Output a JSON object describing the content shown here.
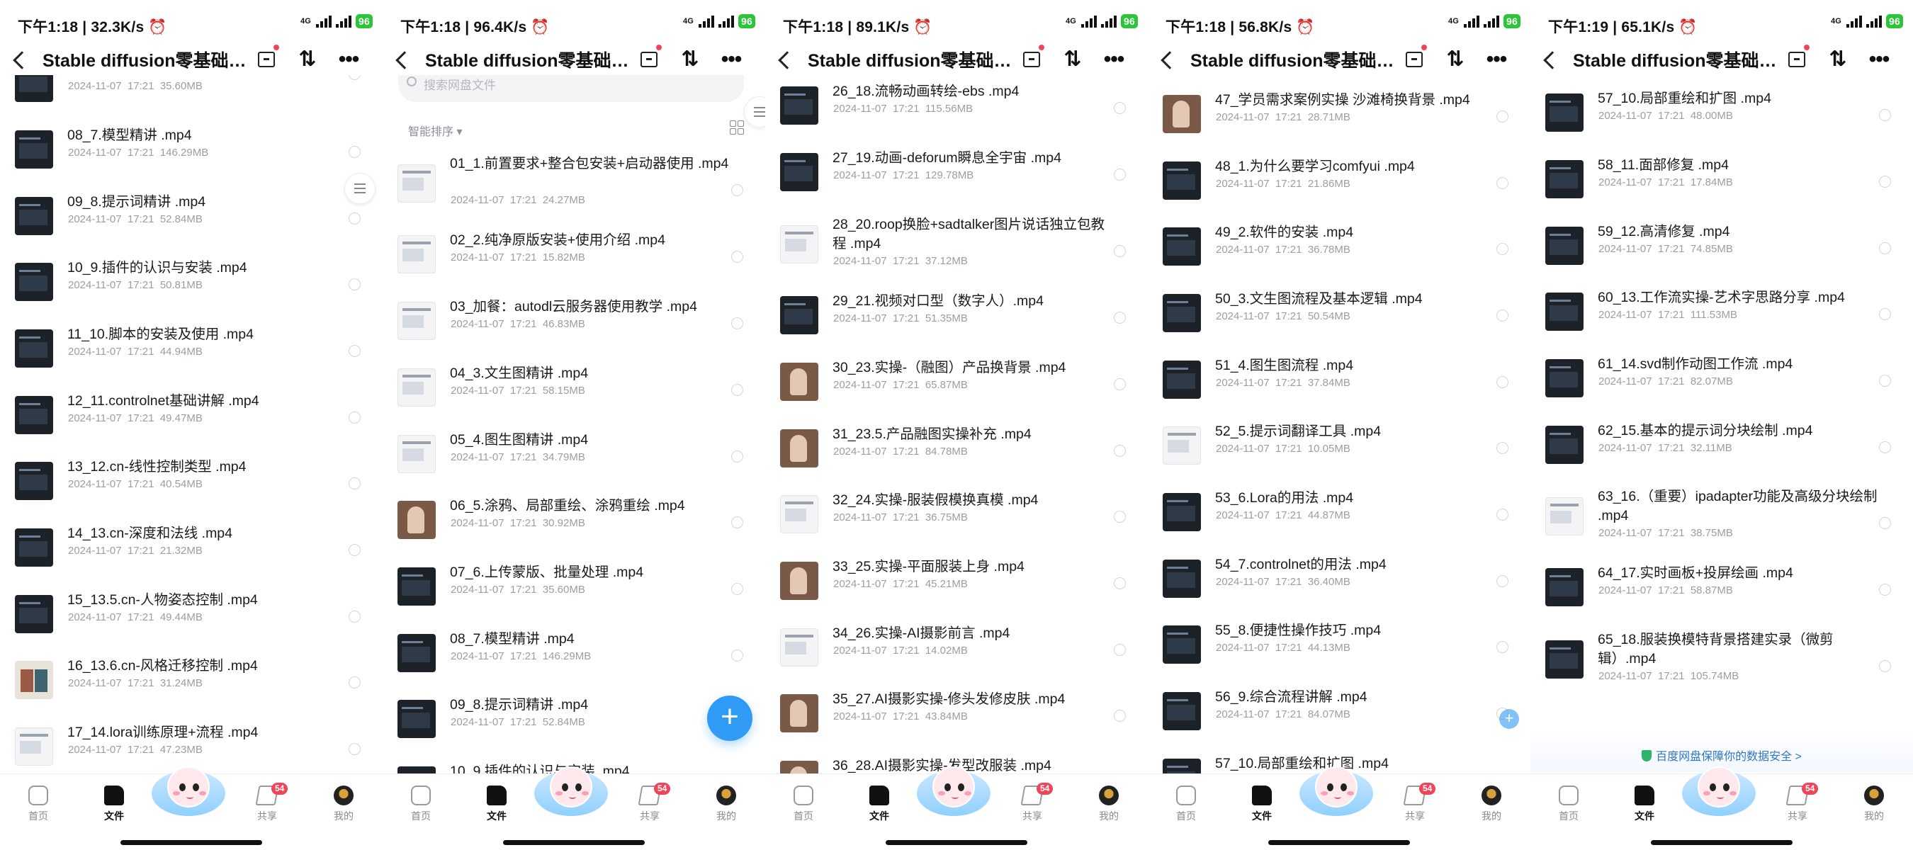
{
  "status_bars": [
    {
      "time": "下午1:18 | 32.3K/s"
    },
    {
      "time": "下午1:18 | 96.4K/s"
    },
    {
      "time": "下午1:18 | 89.1K/s"
    },
    {
      "time": "下午1:18 | 56.8K/s"
    },
    {
      "time": "下午1:19 | 65.1K/s"
    }
  ],
  "network_label": "4G",
  "battery": "96",
  "header": {
    "title": "Stable diffusion零基础…"
  },
  "search": {
    "placeholder": "搜索网盘文件"
  },
  "sort": {
    "label": "智能排序"
  },
  "fab": {
    "label": "+"
  },
  "guarantee": {
    "text": "百度网盘保障你的数据安全 >"
  },
  "nav": {
    "home": "首页",
    "files": "文件",
    "share": "共享",
    "me": "我的",
    "share_badge": "54"
  },
  "panels": [
    {
      "items": [
        {
          "name": "",
          "meta": "2024-11-07  17:21  35.60MB"
        },
        {
          "name": "08_7.模型精讲 .mp4",
          "meta": "2024-11-07  17:21  146.29MB"
        },
        {
          "name": "09_8.提示词精讲 .mp4",
          "meta": "2024-11-07  17:21  52.84MB"
        },
        {
          "name": "10_9.插件的认识与安装 .mp4",
          "meta": "2024-11-07  17:21  50.81MB"
        },
        {
          "name": "11_10.脚本的安装及使用 .mp4",
          "meta": "2024-11-07  17:21  44.94MB"
        },
        {
          "name": "12_11.controlnet基础讲解 .mp4",
          "meta": "2024-11-07  17:21  49.47MB"
        },
        {
          "name": "13_12.cn-线性控制类型 .mp4",
          "meta": "2024-11-07  17:21  40.54MB"
        },
        {
          "name": "14_13.cn-深度和法线 .mp4",
          "meta": "2024-11-07  17:21  21.32MB"
        },
        {
          "name": "15_13.5.cn-人物姿态控制 .mp4",
          "meta": "2024-11-07  17:21  49.44MB"
        },
        {
          "name": "16_13.6.cn-风格迁移控制 .mp4",
          "meta": "2024-11-07  17:21  31.24MB"
        },
        {
          "name": "17_14.lora训练原理+流程 .mp4",
          "meta": "2024-11-07  17:21  47.23MB"
        }
      ]
    },
    {
      "items": [
        {
          "name": "01_1.前置要求+整合包安装+启动器使用 .mp4",
          "meta": "2024-11-07  17:21  24.27MB"
        },
        {
          "name": "02_2.纯净原版安装+使用介绍 .mp4",
          "meta": "2024-11-07  17:21  15.82MB"
        },
        {
          "name": "03_加餐：autodl云服务器使用教学 .mp4",
          "meta": "2024-11-07  17:21  46.83MB"
        },
        {
          "name": "04_3.文生图精讲 .mp4",
          "meta": "2024-11-07  17:21  58.15MB"
        },
        {
          "name": "05_4.图生图精讲 .mp4",
          "meta": "2024-11-07  17:21  34.79MB"
        },
        {
          "name": "06_5.涂鸦、局部重绘、涂鸦重绘 .mp4",
          "meta": "2024-11-07  17:21  30.92MB"
        },
        {
          "name": "07_6.上传蒙版、批量处理 .mp4",
          "meta": "2024-11-07  17:21  35.60MB"
        },
        {
          "name": "08_7.模型精讲 .mp4",
          "meta": "2024-11-07  17:21  146.29MB"
        },
        {
          "name": "09_8.提示词精讲 .mp4",
          "meta": "2024-11-07  17:21  52.84MB"
        },
        {
          "name": "10_9.插件的认识与安装 .mp4",
          "meta": ""
        }
      ]
    },
    {
      "items": [
        {
          "name": "26_18.流畅动画转绘-ebs .mp4",
          "meta": "2024-11-07  17:21  115.56MB"
        },
        {
          "name": "27_19.动画-deforum瞬息全宇宙 .mp4",
          "meta": "2024-11-07  17:21  129.78MB"
        },
        {
          "name": "28_20.roop换脸+sadtalker图片说话独立包教程 .mp4",
          "meta": "2024-11-07  17:21  37.12MB"
        },
        {
          "name": "29_21.视频对口型（数字人）.mp4",
          "meta": "2024-11-07  17:21  51.35MB"
        },
        {
          "name": "30_23.实操-（融图）产品换背景 .mp4",
          "meta": "2024-11-07  17:21  65.87MB"
        },
        {
          "name": "31_23.5.产品融图实操补充 .mp4",
          "meta": "2024-11-07  17:21  84.78MB"
        },
        {
          "name": "32_24.实操-服装假模换真模 .mp4",
          "meta": "2024-11-07  17:21  36.75MB"
        },
        {
          "name": "33_25.实操-平面服装上身 .mp4",
          "meta": "2024-11-07  17:21  45.21MB"
        },
        {
          "name": "34_26.实操-AI摄影前言 .mp4",
          "meta": "2024-11-07  17:21  14.02MB"
        },
        {
          "name": "35_27.AI摄影实操-修头发修皮肤 .mp4",
          "meta": "2024-11-07  17:21  43.84MB"
        },
        {
          "name": "36_28.AI摄影实操-发型改服装 .mp4",
          "meta": ""
        }
      ]
    },
    {
      "items": [
        {
          "name": "47_学员需求案例实操 沙滩椅换背景 .mp4",
          "meta": "2024-11-07  17:21  28.71MB"
        },
        {
          "name": "48_1.为什么要学习comfyui .mp4",
          "meta": "2024-11-07  17:21  21.86MB"
        },
        {
          "name": "49_2.软件的安装 .mp4",
          "meta": "2024-11-07  17:21  36.78MB"
        },
        {
          "name": "50_3.文生图流程及基本逻辑 .mp4",
          "meta": "2024-11-07  17:21  50.54MB"
        },
        {
          "name": "51_4.图生图流程 .mp4",
          "meta": "2024-11-07  17:21  37.84MB"
        },
        {
          "name": "52_5.提示词翻译工具 .mp4",
          "meta": "2024-11-07  17:21  10.05MB"
        },
        {
          "name": "53_6.Lora的用法 .mp4",
          "meta": "2024-11-07  17:21  44.87MB"
        },
        {
          "name": "54_7.controlnet的用法 .mp4",
          "meta": "2024-11-07  17:21  36.40MB"
        },
        {
          "name": "55_8.便捷性操作技巧 .mp4",
          "meta": "2024-11-07  17:21  44.13MB"
        },
        {
          "name": "56_9.综合流程讲解 .mp4",
          "meta": "2024-11-07  17:21  84.07MB"
        },
        {
          "name": "57_10.局部重绘和扩图 .mp4",
          "meta": ""
        }
      ]
    },
    {
      "items": [
        {
          "name": "57_10.局部重绘和扩图 .mp4",
          "meta": "2024-11-07  17:21  48.00MB"
        },
        {
          "name": "58_11.面部修复 .mp4",
          "meta": "2024-11-07  17:21  17.84MB"
        },
        {
          "name": "59_12.高清修复 .mp4",
          "meta": "2024-11-07  17:21  74.85MB"
        },
        {
          "name": "60_13.工作流实操-艺术字思路分享 .mp4",
          "meta": "2024-11-07  17:21  111.53MB"
        },
        {
          "name": "61_14.svd制作动图工作流 .mp4",
          "meta": "2024-11-07  17:21  82.07MB"
        },
        {
          "name": "62_15.基本的提示词分块绘制 .mp4",
          "meta": "2024-11-07  17:21  32.11MB"
        },
        {
          "name": "63_16.（重要）ipadapter功能及高级分块绘制 .mp4",
          "meta": "2024-11-07  17:21  38.75MB"
        },
        {
          "name": "64_17.实时画板+投屏绘画 .mp4",
          "meta": "2024-11-07  17:21  58.87MB"
        },
        {
          "name": "65_18.服装换模特背景搭建实录（微剪辑）.mp4",
          "meta": "2024-11-07  17:21  105.74MB"
        }
      ]
    }
  ]
}
